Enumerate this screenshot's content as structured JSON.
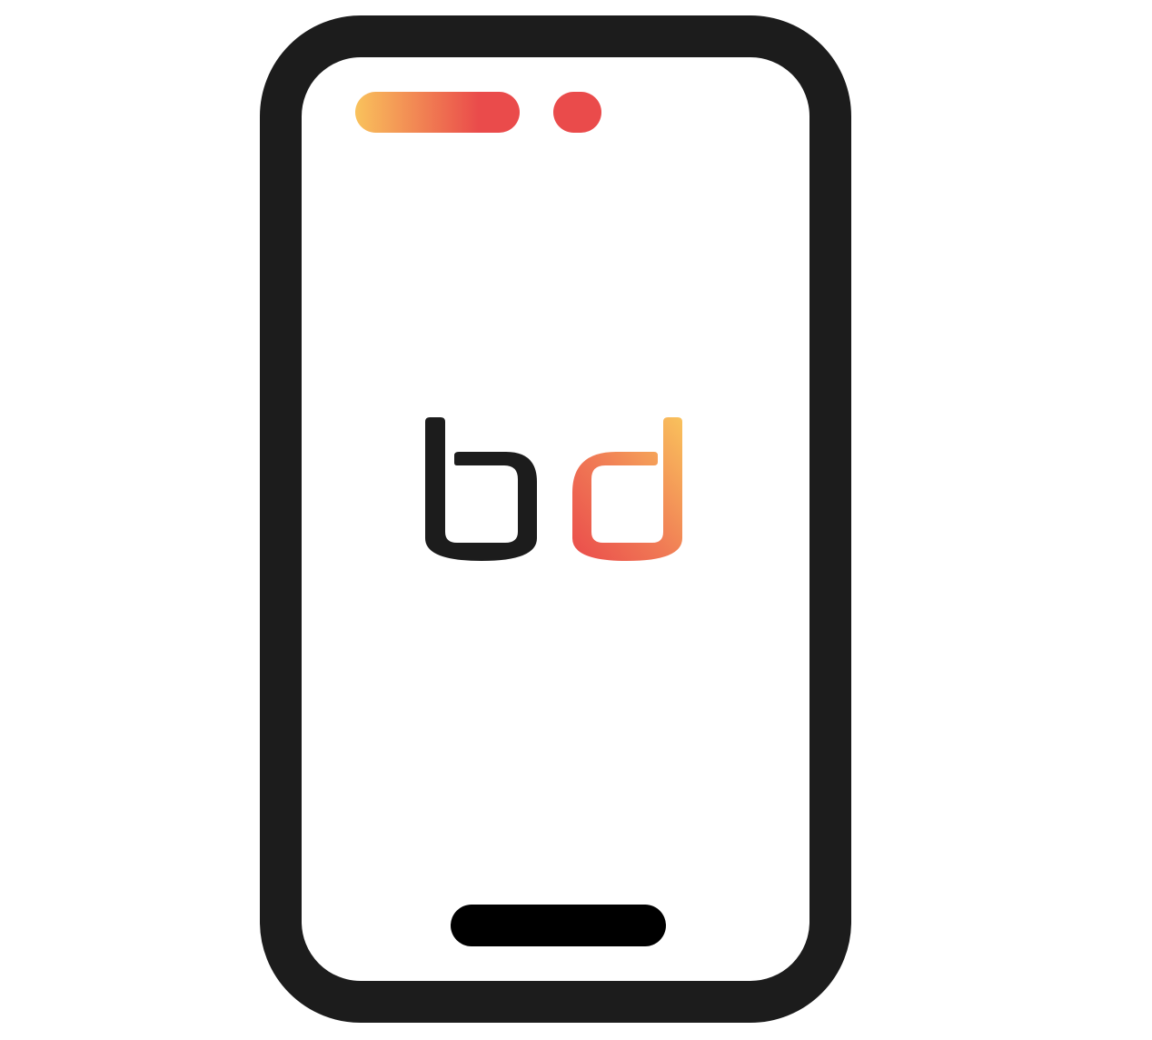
{
  "logo": {
    "text": "bd",
    "letters": [
      "b",
      "d"
    ]
  },
  "icons": {
    "device": "smartphone-icon",
    "speaker": "speaker-slot-icon",
    "camera": "front-camera-icon",
    "home": "home-indicator-icon"
  },
  "colors": {
    "frame": "#1c1c1c",
    "screen": "#ffffff",
    "accent_yellow": "#f9c25c",
    "accent_red": "#ea4b4b",
    "letter_b": "#1c1c1c",
    "home_bar": "#000000"
  }
}
